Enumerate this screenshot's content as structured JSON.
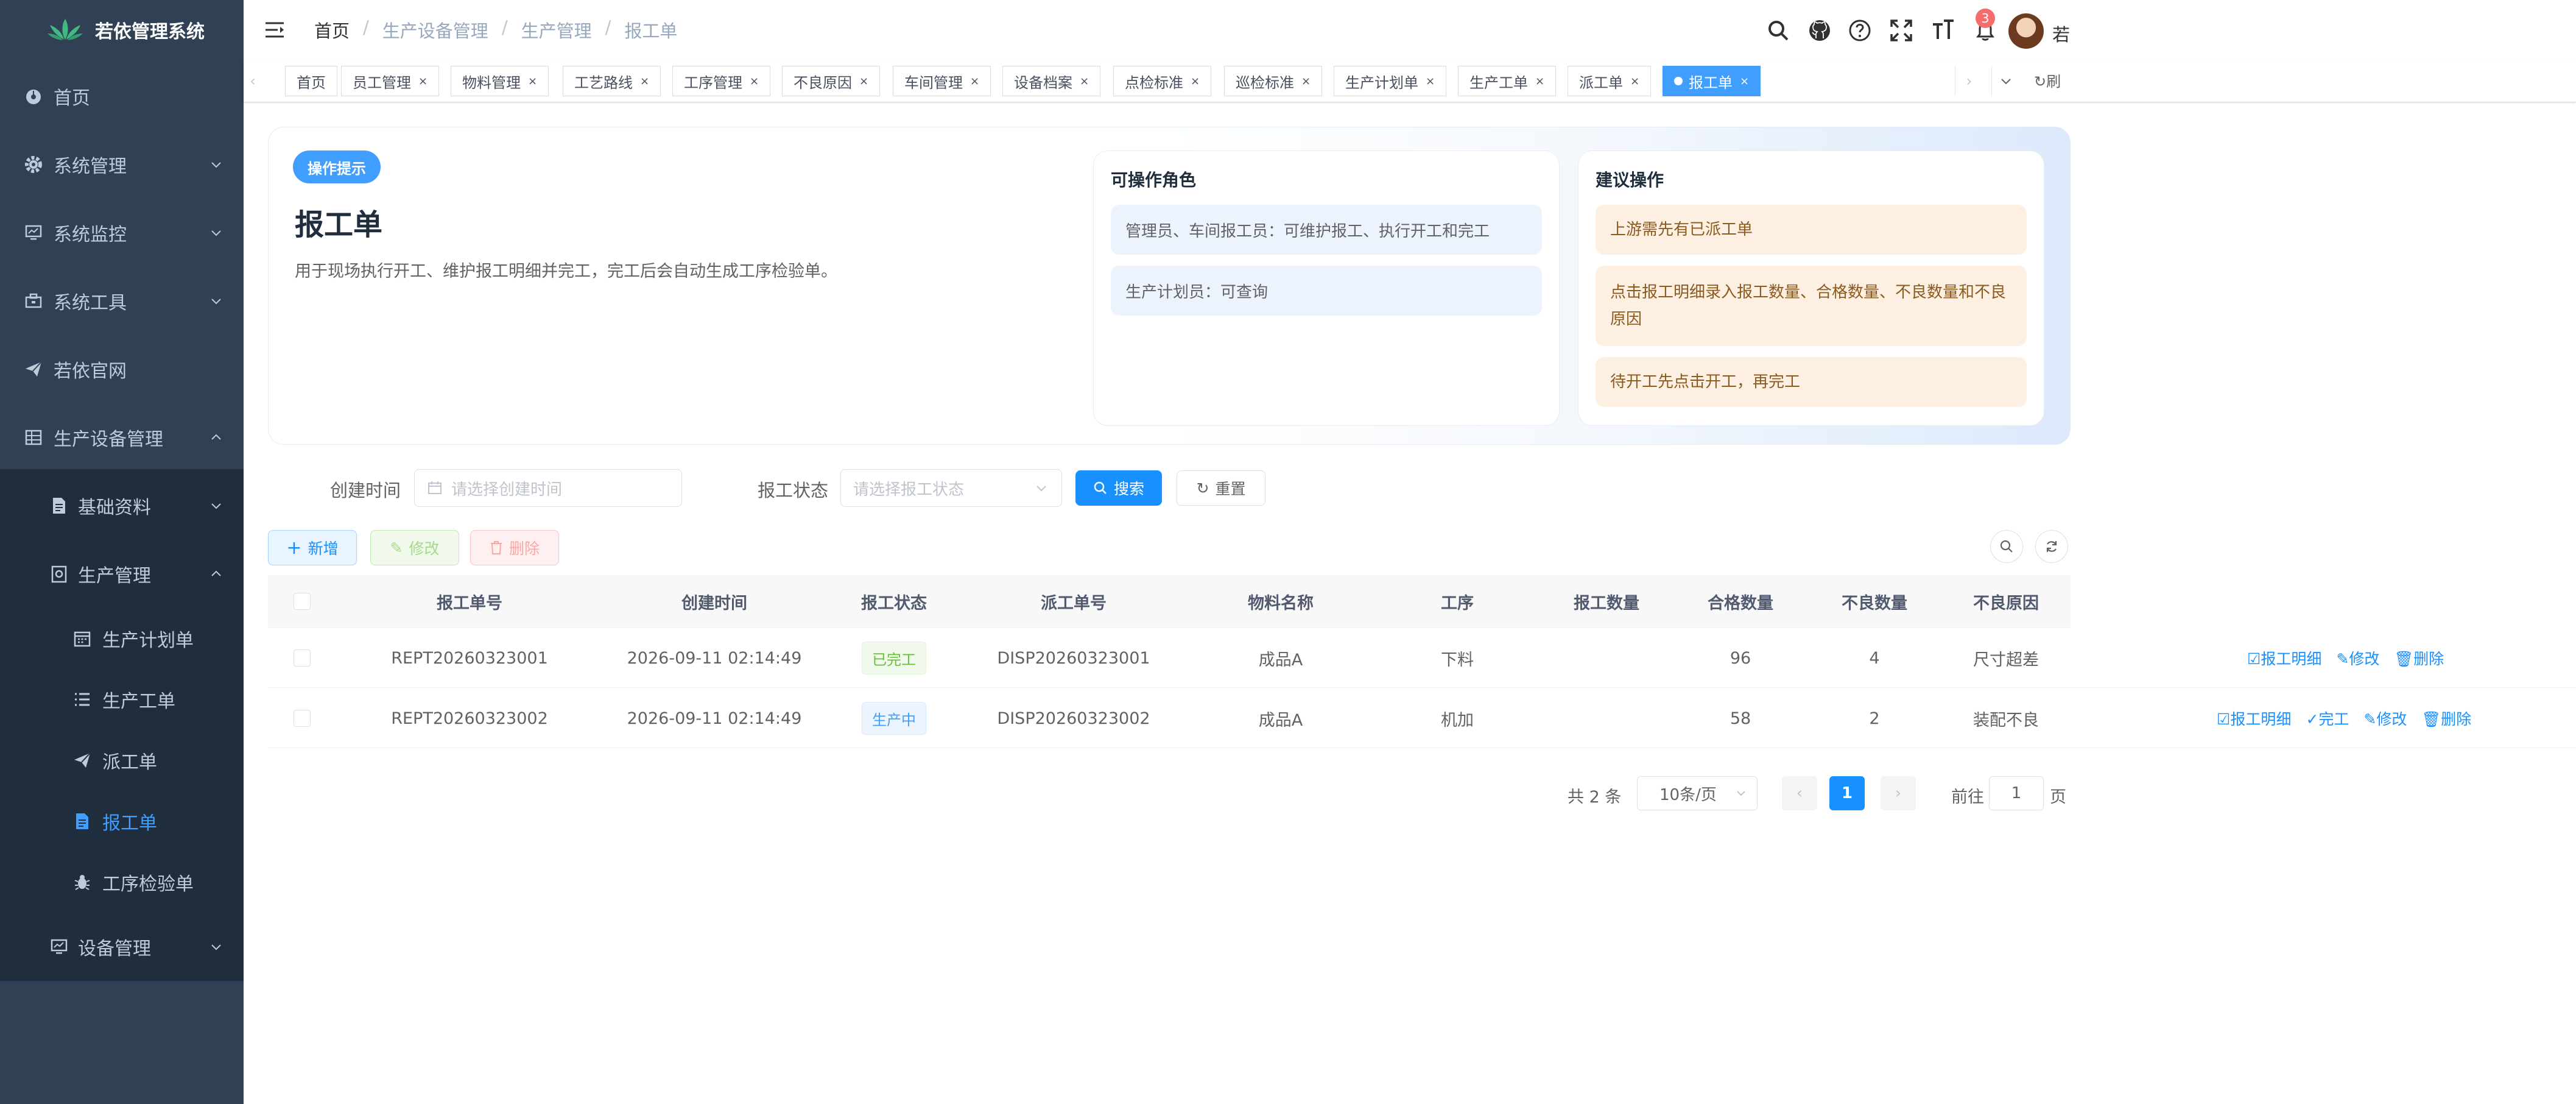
{
  "app": {
    "title": "若依管理系统"
  },
  "sidebar": {
    "items": [
      {
        "label": "首页",
        "icon": "dashboard-icon"
      },
      {
        "label": "系统管理",
        "icon": "gear-icon"
      },
      {
        "label": "系统监控",
        "icon": "monitor-icon"
      },
      {
        "label": "系统工具",
        "icon": "toolbox-icon"
      },
      {
        "label": "若依官网",
        "icon": "send-icon"
      },
      {
        "label": "生产设备管理",
        "icon": "table-icon"
      },
      {
        "label": "基础资料",
        "icon": "document-icon"
      },
      {
        "label": "生产管理",
        "icon": "clipboard-icon"
      },
      {
        "label": "生产计划单",
        "icon": "calendar-icon"
      },
      {
        "label": "生产工单",
        "icon": "list-icon"
      },
      {
        "label": "派工单",
        "icon": "send-icon"
      },
      {
        "label": "报工单",
        "icon": "document-icon"
      },
      {
        "label": "工序检验单",
        "icon": "bug-icon"
      },
      {
        "label": "设备管理",
        "icon": "monitor-icon"
      }
    ],
    "active_color": "#409eff"
  },
  "breadcrumb": [
    "首页",
    "生产设备管理",
    "生产管理",
    "报工单"
  ],
  "navbar": {
    "notification_count": "3",
    "user_name": "若"
  },
  "tags": [
    {
      "label": "首页"
    },
    {
      "label": "员工管理"
    },
    {
      "label": "物料管理"
    },
    {
      "label": "工艺路线"
    },
    {
      "label": "工序管理"
    },
    {
      "label": "不良原因"
    },
    {
      "label": "车间管理"
    },
    {
      "label": "设备档案"
    },
    {
      "label": "点检标准"
    },
    {
      "label": "巡检标准"
    },
    {
      "label": "生产计划单"
    },
    {
      "label": "生产工单"
    },
    {
      "label": "派工单"
    },
    {
      "label": "报工单"
    }
  ],
  "tags_refresh": "刷",
  "tip": {
    "badge": "操作提示",
    "title": "报工单",
    "desc": "用于现场执行开工、维护报工明细并完工，完工后会自动生成工序检验单。",
    "roles_title": "可操作角色",
    "roles": [
      "管理员、车间报工员：可维护报工、执行开工和完工",
      "生产计划员：可查询"
    ],
    "suggest_title": "建议操作",
    "suggestions": [
      "上游需先有已派工单",
      "点击报工明细录入报工数量、合格数量、不良数量和不良原因",
      "待开工先点击开工，再完工"
    ]
  },
  "search": {
    "create_time_label": "创建时间",
    "create_time_placeholder": "请选择创建时间",
    "status_label": "报工状态",
    "status_placeholder": "请选择报工状态",
    "search_btn": "搜索",
    "reset_btn": "重置"
  },
  "toolbar": {
    "add": "新增",
    "edit": "修改",
    "delete": "删除"
  },
  "table": {
    "headers": [
      "报工单号",
      "创建时间",
      "报工状态",
      "派工单号",
      "物料名称",
      "工序",
      "报工数量",
      "合格数量",
      "不良数量",
      "不良原因"
    ],
    "rows": [
      {
        "no": "REPT20260323001",
        "time": "2026-09-11 02:14:49",
        "status": "已完工",
        "dispatch": "DISP20260323001",
        "material": "成品A",
        "process": "下料",
        "qty": "",
        "good": "96",
        "bad": "4",
        "reason": "尺寸超差",
        "ops": [
          "报工明细",
          "修改",
          "删除"
        ]
      },
      {
        "no": "REPT20260323002",
        "time": "2026-09-11 02:14:49",
        "status": "生产中",
        "dispatch": "DISP20260323002",
        "material": "成品A",
        "process": "机加",
        "qty": "",
        "good": "58",
        "bad": "2",
        "reason": "装配不良",
        "ops": [
          "报工明细",
          "完工",
          "修改",
          "删除"
        ]
      }
    ]
  },
  "pagination": {
    "total": "共 2 条",
    "page_size": "10条/页",
    "current": "1",
    "goto_label": "前往",
    "goto_value": "1",
    "page_unit": "页"
  }
}
